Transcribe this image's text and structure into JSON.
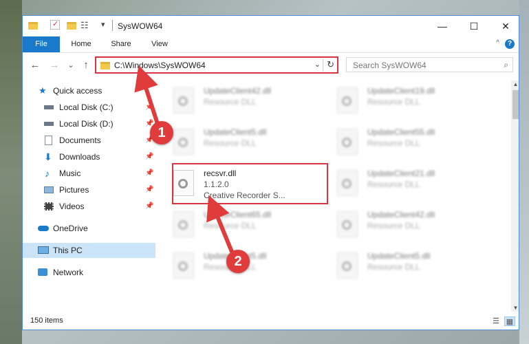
{
  "window": {
    "title": "SysWOW64",
    "controls": {
      "minimize": "—",
      "maximize": "☐",
      "close": "✕"
    }
  },
  "quick_access_toolbar": {
    "dropdown": "▾"
  },
  "ribbon": {
    "tabs": [
      "File",
      "Home",
      "Share",
      "View"
    ],
    "help": "?",
    "collapse": "^"
  },
  "nav": {
    "back": "←",
    "forward": "→",
    "recent": "⌄",
    "up": "↑"
  },
  "address": {
    "path": "C:\\Windows\\SysWOW64",
    "dropdown": "⌄",
    "refresh": "↻"
  },
  "search": {
    "placeholder": "Search SysWOW64",
    "icon": "⌕"
  },
  "sidebar": {
    "items": [
      {
        "label": "Quick access",
        "icon": "star-icon"
      },
      {
        "label": "Local Disk (C:)",
        "icon": "drive-icon"
      },
      {
        "label": "Local Disk (D:)",
        "icon": "drive-icon"
      },
      {
        "label": "Documents",
        "icon": "document-icon"
      },
      {
        "label": "Downloads",
        "icon": "download-icon"
      },
      {
        "label": "Music",
        "icon": "music-icon"
      },
      {
        "label": "Pictures",
        "icon": "picture-icon"
      },
      {
        "label": "Videos",
        "icon": "video-icon"
      },
      {
        "label": "OneDrive",
        "icon": "cloud-icon"
      },
      {
        "label": "This PC",
        "icon": "computer-icon"
      },
      {
        "label": "Network",
        "icon": "network-icon"
      }
    ],
    "pin": "📌"
  },
  "files": {
    "left": [
      {
        "name": "UpdateClient42.dll",
        "type": "Resource DLL"
      },
      {
        "name": "UpdateClient5.dll",
        "type": "Resource DLL"
      },
      {
        "name": "recsvr.dll",
        "version": "1.1.2.0",
        "desc": "Creative Recorder S..."
      },
      {
        "name": "UpdateClient65.dll",
        "type": "Resource DLL"
      },
      {
        "name": "UpdateClient5.dll",
        "type": "Resource DLL"
      }
    ],
    "right": [
      {
        "name": "UpdateClient19.dll",
        "type": "Resource DLL"
      },
      {
        "name": "UpdateClient55.dll",
        "type": "Resource DLL"
      },
      {
        "name": "UpdateClient21.dll",
        "type": "Resource DLL"
      },
      {
        "name": "UpdateClient42.dll",
        "type": "Resource DLL"
      },
      {
        "name": "UpdateClient5.dll",
        "type": "Resource DLL"
      }
    ]
  },
  "status": {
    "item_count": "150 items"
  },
  "annotations": {
    "step1": "1",
    "step2": "2",
    "color": "#e03c3c"
  },
  "colors": {
    "accent": "#1979ca",
    "highlight": "#d9343f",
    "selected": "#cce4f7"
  }
}
